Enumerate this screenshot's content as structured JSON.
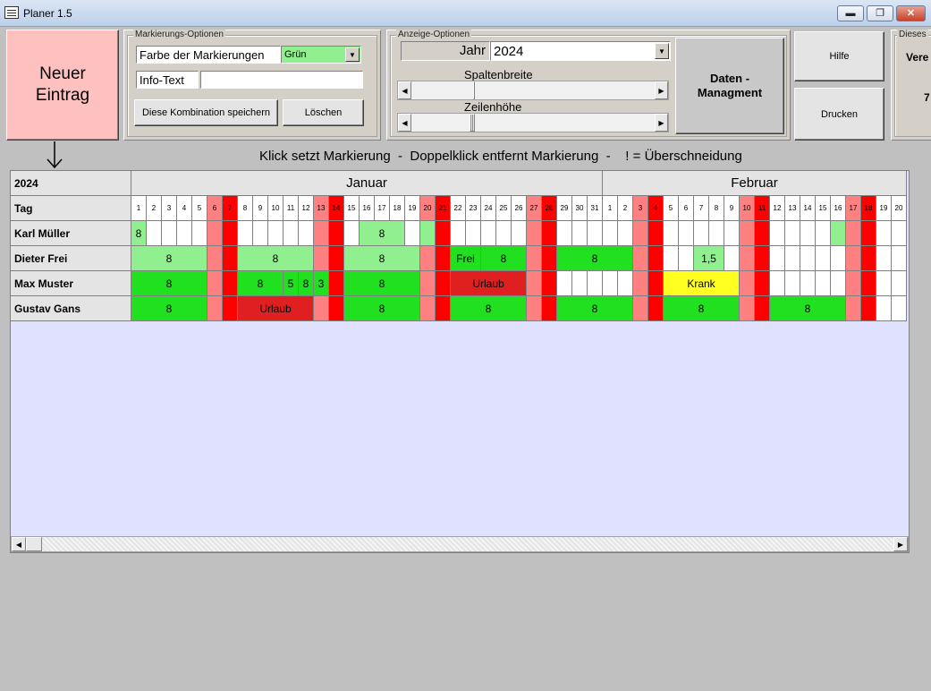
{
  "window": {
    "title": "Planer 1.5",
    "minimize": "▬",
    "maximize": "❐",
    "close": "✕"
  },
  "toolbar": {
    "new_entry_line1": "Neuer",
    "new_entry_line2": "Eintrag",
    "marking_group": "Markierungs-Optionen",
    "color_label": "Farbe der Markierungen",
    "color_value": "Grün",
    "info_label": "Info-Text",
    "info_value": "",
    "save_combo": "Diese Kombination speichern",
    "delete": "Löschen",
    "display_group": "Anzeige-Optionen",
    "year_label": "Jahr",
    "year_value": "2024",
    "col_width_label": "Spaltenbreite",
    "row_height_label": "Zeilenhöhe",
    "data_mgmt_line1": "Daten -",
    "data_mgmt_line2": "Managment",
    "help": "Hilfe",
    "print": "Drucken",
    "cut_group": "Dieses",
    "cut_text1": "Vere",
    "cut_text2": "7"
  },
  "hint": "Klick setzt Markierung  -  Doppelklick entfernt Markierung  -    ! = Überschneidung",
  "calendar": {
    "year": "2024",
    "day_label": "Tag",
    "months": [
      {
        "name": "Januar",
        "days": 31
      },
      {
        "name": "Februar",
        "days": 20
      }
    ],
    "day_numbers": [
      "1",
      "2",
      "3",
      "4",
      "5",
      "6",
      "7",
      "8",
      "9",
      "10",
      "11",
      "12",
      "13",
      "14",
      "15",
      "16",
      "17",
      "18",
      "19",
      "20",
      "21",
      "22",
      "23",
      "24",
      "25",
      "26",
      "27",
      "28",
      "29",
      "30",
      "31",
      "1",
      "2",
      "3",
      "4",
      "5",
      "6",
      "7",
      "8",
      "9",
      "10",
      "11",
      "12",
      "13",
      "14",
      "15",
      "16",
      "17",
      "18",
      "19",
      "20"
    ],
    "weekend_pink": [
      6,
      13,
      20,
      27,
      34,
      41,
      48
    ],
    "weekend_red": [
      7,
      14,
      21,
      28,
      35,
      42,
      49
    ],
    "people": [
      {
        "name": "Karl Müller",
        "entries": [
          {
            "start": 1,
            "span": 1,
            "label": "8",
            "color": "#90f090"
          },
          {
            "start": 16,
            "span": 3,
            "label": "8",
            "color": "#90f090"
          },
          {
            "start": 20,
            "span": 1,
            "label": "",
            "color": "#90f090"
          },
          {
            "start": 47,
            "span": 1,
            "label": "",
            "color": "#90f090"
          }
        ]
      },
      {
        "name": "Dieter Frei",
        "entries": [
          {
            "start": 1,
            "span": 5,
            "label": "8",
            "color": "#90f090"
          },
          {
            "start": 8,
            "span": 5,
            "label": "8",
            "color": "#90f090"
          },
          {
            "start": 15,
            "span": 5,
            "label": "8",
            "color": "#90f090"
          },
          {
            "start": 22,
            "span": 2,
            "label": "Frei",
            "color": "#20e020"
          },
          {
            "start": 24,
            "span": 3,
            "label": "8",
            "color": "#20e020"
          },
          {
            "start": 29,
            "span": 5,
            "label": "8",
            "color": "#20e020"
          },
          {
            "start": 38,
            "span": 2,
            "label": "1,5",
            "color": "#90f090"
          }
        ]
      },
      {
        "name": "Max Muster",
        "entries": [
          {
            "start": 1,
            "span": 5,
            "label": "8",
            "color": "#20e020"
          },
          {
            "start": 8,
            "span": 3,
            "label": "8",
            "color": "#20e020"
          },
          {
            "start": 11,
            "span": 1,
            "label": "5",
            "color": "#20e020"
          },
          {
            "start": 12,
            "span": 1,
            "label": "8",
            "color": "#20e020"
          },
          {
            "start": 13,
            "span": 1,
            "label": "3",
            "color": "#20e020"
          },
          {
            "start": 15,
            "span": 5,
            "label": "8",
            "color": "#20e020"
          },
          {
            "start": 22,
            "span": 5,
            "label": "Urlaub",
            "color": "#e02020"
          },
          {
            "start": 36,
            "span": 5,
            "label": "Krank",
            "color": "#ffff20"
          }
        ]
      },
      {
        "name": "Gustav Gans",
        "entries": [
          {
            "start": 1,
            "span": 5,
            "label": "8",
            "color": "#20e020"
          },
          {
            "start": 8,
            "span": 5,
            "label": "Urlaub",
            "color": "#e02020"
          },
          {
            "start": 15,
            "span": 5,
            "label": "8",
            "color": "#20e020"
          },
          {
            "start": 22,
            "span": 5,
            "label": "8",
            "color": "#20e020"
          },
          {
            "start": 29,
            "span": 5,
            "label": "8",
            "color": "#20e020"
          },
          {
            "start": 36,
            "span": 5,
            "label": "8",
            "color": "#20e020"
          },
          {
            "start": 43,
            "span": 5,
            "label": "8",
            "color": "#20e020"
          }
        ]
      }
    ]
  },
  "colors": {
    "new_entry_bg": "#ffc0c0",
    "weekend_pink": "#ff8080",
    "weekend_red": "#ff0000",
    "grid_empty": "#e0e0ff",
    "color_combo_bg": "#90f090"
  }
}
